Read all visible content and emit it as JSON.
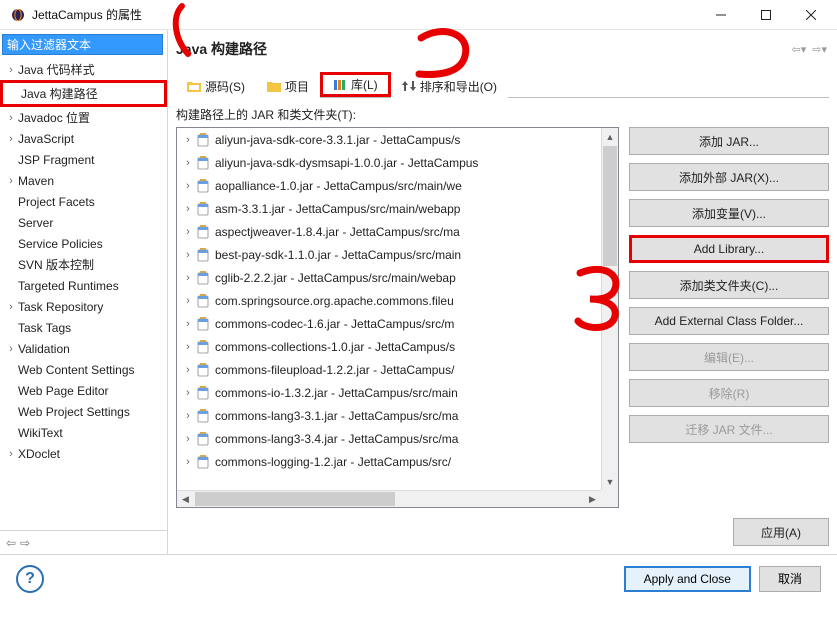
{
  "window": {
    "title": "JettaCampus 的属性",
    "minimize": "—",
    "maximize": "☐",
    "close": "✕"
  },
  "filter_placeholder": "输入过滤器文本",
  "sidebar": {
    "items": [
      {
        "label": "Java 代码样式",
        "exp": "›"
      },
      {
        "label": "Java 构建路径",
        "exp": " "
      },
      {
        "label": "Javadoc 位置",
        "exp": "›"
      },
      {
        "label": "JavaScript",
        "exp": "›"
      },
      {
        "label": "JSP Fragment",
        "exp": " "
      },
      {
        "label": "Maven",
        "exp": "›"
      },
      {
        "label": "Project Facets",
        "exp": " "
      },
      {
        "label": "Server",
        "exp": " "
      },
      {
        "label": "Service Policies",
        "exp": " "
      },
      {
        "label": "SVN 版本控制",
        "exp": " "
      },
      {
        "label": "Targeted Runtimes",
        "exp": " "
      },
      {
        "label": "Task Repository",
        "exp": "›"
      },
      {
        "label": "Task Tags",
        "exp": " "
      },
      {
        "label": "Validation",
        "exp": "›"
      },
      {
        "label": "Web Content Settings",
        "exp": " "
      },
      {
        "label": "Web Page Editor",
        "exp": " "
      },
      {
        "label": "Web Project Settings",
        "exp": " "
      },
      {
        "label": "WikiText",
        "exp": " "
      },
      {
        "label": "XDoclet",
        "exp": "›"
      }
    ]
  },
  "main": {
    "title": "Java 构建路径"
  },
  "tabs": [
    {
      "label": "源码(S)"
    },
    {
      "label": "项目"
    },
    {
      "label": "库(L)"
    },
    {
      "label": "排序和导出(O)"
    }
  ],
  "content_label": "构建路径上的 JAR 和类文件夹(T):",
  "list": [
    "aliyun-java-sdk-core-3.3.1.jar - JettaCampus/s",
    "aliyun-java-sdk-dysmsapi-1.0.0.jar - JettaCampus",
    "aopalliance-1.0.jar - JettaCampus/src/main/we",
    "asm-3.3.1.jar - JettaCampus/src/main/webapp",
    "aspectjweaver-1.8.4.jar - JettaCampus/src/ma",
    "best-pay-sdk-1.1.0.jar - JettaCampus/src/main",
    "cglib-2.2.2.jar - JettaCampus/src/main/webap",
    "com.springsource.org.apache.commons.fileu",
    "commons-codec-1.6.jar - JettaCampus/src/m",
    "commons-collections-1.0.jar - JettaCampus/s",
    "commons-fileupload-1.2.2.jar - JettaCampus/",
    "commons-io-1.3.2.jar - JettaCampus/src/main",
    "commons-lang3-3.1.jar - JettaCampus/src/ma",
    "commons-lang3-3.4.jar - JettaCampus/src/ma",
    "commons-logging-1.2.jar - JettaCampus/src/"
  ],
  "buttons": {
    "add_jar": "添加 JAR...",
    "add_ext_jar": "添加外部 JAR(X)...",
    "add_var": "添加变量(V)...",
    "add_lib": "Add Library...",
    "add_class": "添加类文件夹(C)...",
    "add_ext_class": "Add External Class Folder...",
    "edit": "编辑(E)...",
    "remove": "移除(R)",
    "migrate": "迁移 JAR 文件..."
  },
  "apply": "应用(A)",
  "footer": {
    "apply_close": "Apply and Close",
    "cancel": "取消"
  }
}
